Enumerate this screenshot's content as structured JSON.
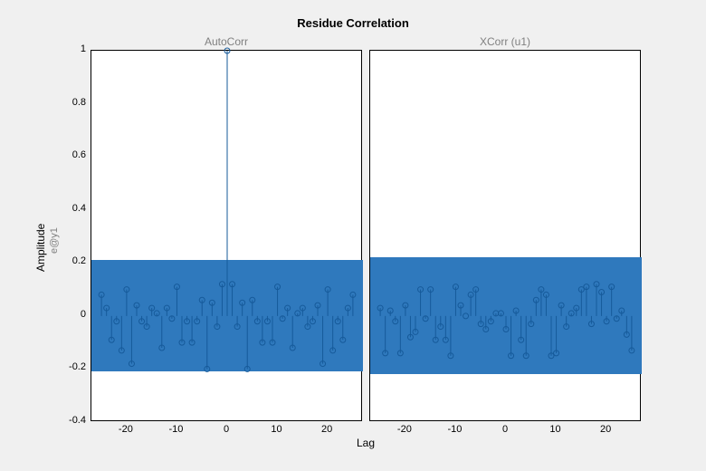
{
  "title": "Residue Correlation",
  "xlabel": "Lag",
  "ylabel_main": "Amplitude",
  "ylabel_sub": "e@y1",
  "left_subtitle": "AutoCorr",
  "right_subtitle": "XCorr (u1)",
  "chart_data": [
    {
      "type": "stem",
      "name": "AutoCorr",
      "title": "AutoCorr",
      "xlabel": "Lag",
      "ylabel": "Amplitude (e@y1)",
      "xlim": [
        -27,
        27
      ],
      "ylim": [
        -0.4,
        1.0
      ],
      "xticks": [
        -20,
        -10,
        0,
        10,
        20
      ],
      "yticks": [
        -0.4,
        -0.2,
        0,
        0.2,
        0.4,
        0.6,
        0.8,
        1
      ],
      "confidence_band": [
        -0.21,
        0.21
      ],
      "x": [
        -25,
        -24,
        -23,
        -22,
        -21,
        -20,
        -19,
        -18,
        -17,
        -16,
        -15,
        -14,
        -13,
        -12,
        -11,
        -10,
        -9,
        -8,
        -7,
        -6,
        -5,
        -4,
        -3,
        -2,
        -1,
        0,
        1,
        2,
        3,
        4,
        5,
        6,
        7,
        8,
        9,
        10,
        11,
        12,
        13,
        14,
        15,
        16,
        17,
        18,
        19,
        20,
        21,
        22,
        23,
        24,
        25
      ],
      "y": [
        0.08,
        0.03,
        -0.09,
        -0.02,
        -0.13,
        0.1,
        -0.18,
        0.04,
        -0.02,
        -0.04,
        0.03,
        0.01,
        -0.12,
        0.03,
        -0.01,
        0.11,
        -0.1,
        -0.02,
        -0.1,
        -0.02,
        0.06,
        -0.2,
        0.05,
        -0.04,
        0.12,
        1.0,
        0.12,
        -0.04,
        0.05,
        -0.2,
        0.06,
        -0.02,
        -0.1,
        -0.02,
        -0.1,
        0.11,
        -0.01,
        0.03,
        -0.12,
        0.01,
        0.03,
        -0.04,
        -0.02,
        0.04,
        -0.18,
        0.1,
        -0.13,
        -0.02,
        -0.09,
        0.03,
        0.08
      ]
    },
    {
      "type": "stem",
      "name": "XCorr (u1)",
      "title": "XCorr (u1)",
      "xlabel": "Lag",
      "ylabel": "Amplitude (e@y1)",
      "xlim": [
        -27,
        27
      ],
      "ylim": [
        -0.4,
        1.0
      ],
      "xticks": [
        -20,
        -10,
        0,
        10,
        20
      ],
      "yticks": [
        -0.4,
        -0.2,
        0,
        0.2,
        0.4,
        0.6,
        0.8,
        1
      ],
      "confidence_band": [
        -0.22,
        0.22
      ],
      "x": [
        -25,
        -24,
        -23,
        -22,
        -21,
        -20,
        -19,
        -18,
        -17,
        -16,
        -15,
        -14,
        -13,
        -12,
        -11,
        -10,
        -9,
        -8,
        -7,
        -6,
        -5,
        -4,
        -3,
        -2,
        -1,
        0,
        1,
        2,
        3,
        4,
        5,
        6,
        7,
        8,
        9,
        10,
        11,
        12,
        13,
        14,
        15,
        16,
        17,
        18,
        19,
        20,
        21,
        22,
        23,
        24,
        25
      ],
      "y": [
        0.03,
        -0.14,
        0.02,
        -0.02,
        -0.14,
        0.04,
        -0.08,
        -0.06,
        0.1,
        -0.01,
        0.1,
        -0.09,
        -0.04,
        -0.09,
        -0.15,
        0.11,
        0.04,
        -0.0,
        0.08,
        0.1,
        -0.03,
        -0.05,
        -0.02,
        0.01,
        0.01,
        -0.05,
        -0.15,
        0.02,
        -0.09,
        -0.15,
        -0.03,
        0.06,
        0.1,
        0.08,
        -0.15,
        -0.14,
        0.04,
        -0.04,
        0.01,
        0.03,
        0.1,
        0.11,
        -0.03,
        0.12,
        0.09,
        -0.02,
        0.11,
        -0.01,
        0.02,
        -0.07,
        -0.13
      ]
    }
  ]
}
